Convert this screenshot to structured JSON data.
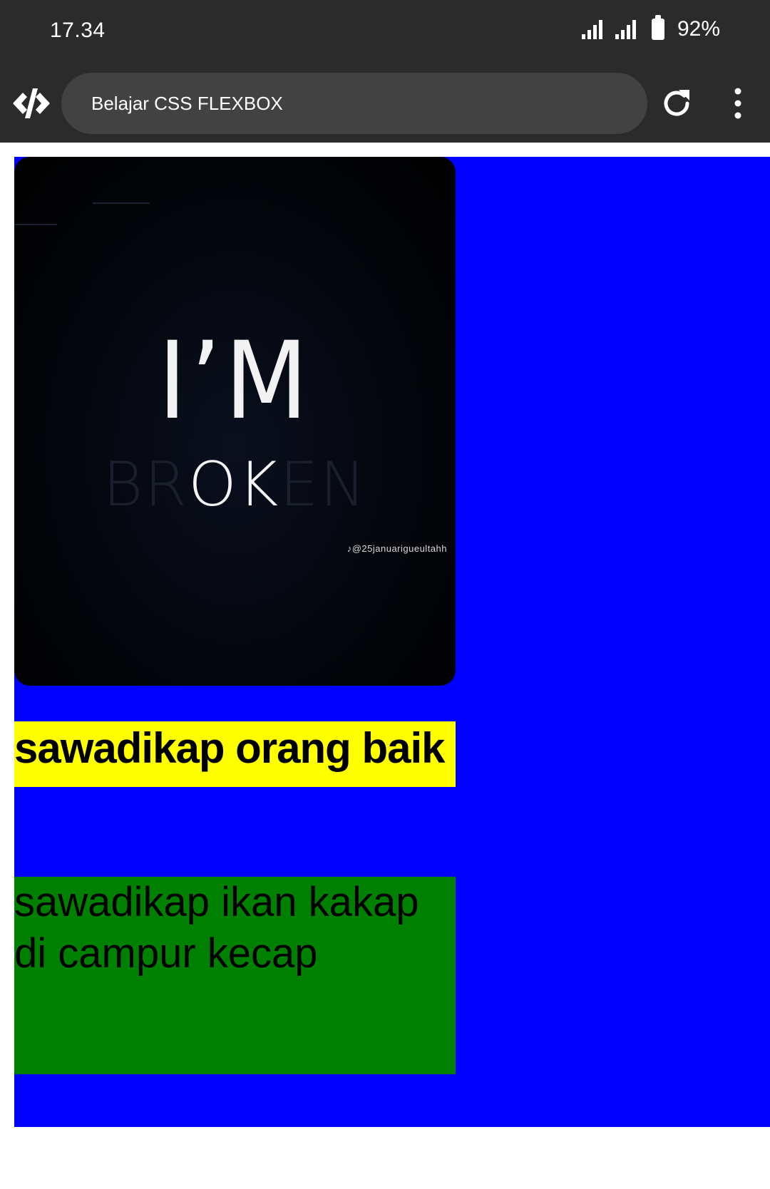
{
  "status_bar": {
    "time": "17.34",
    "battery": "92%"
  },
  "app_bar": {
    "title": "Belajar CSS FLEXBOX",
    "logo_icon": "code-icon",
    "reload_icon": "reload-icon",
    "menu_icon": "more-vert-icon"
  },
  "content": {
    "image": {
      "line1": "I’M",
      "line2_pre": "BR",
      "line2_ok": "OK",
      "line2_post": "EN",
      "watermark": "♪@25januarigueultahh"
    },
    "yellow_text": "sawadikap orang baik",
    "green_text": "sawadikap ikan kakap di campur kecap"
  },
  "colors": {
    "container": "#0000ff",
    "yellow": "#ffff00",
    "green": "#008000",
    "bar": "#2b2b2b"
  }
}
